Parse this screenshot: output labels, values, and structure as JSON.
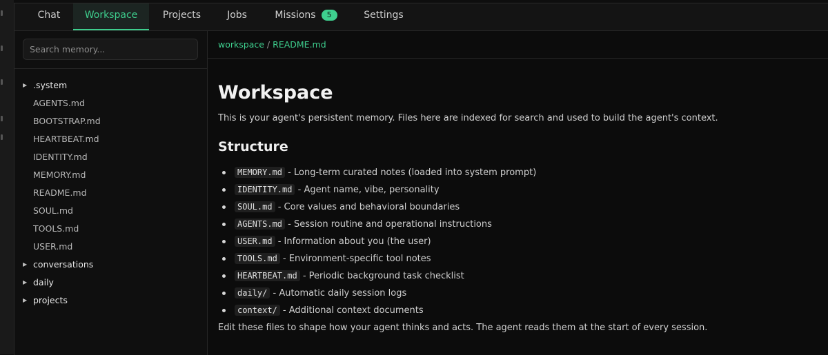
{
  "tabs": [
    {
      "label": "Chat"
    },
    {
      "label": "Workspace",
      "active": true
    },
    {
      "label": "Projects"
    },
    {
      "label": "Jobs"
    },
    {
      "label": "Missions",
      "badge": "5"
    },
    {
      "label": "Settings"
    }
  ],
  "sidebar": {
    "search_placeholder": "Search memory...",
    "tree": [
      {
        "type": "folder",
        "label": ".system"
      },
      {
        "type": "file",
        "label": "AGENTS.md"
      },
      {
        "type": "file",
        "label": "BOOTSTRAP.md"
      },
      {
        "type": "file",
        "label": "HEARTBEAT.md"
      },
      {
        "type": "file",
        "label": "IDENTITY.md"
      },
      {
        "type": "file",
        "label": "MEMORY.md"
      },
      {
        "type": "file",
        "label": "README.md"
      },
      {
        "type": "file",
        "label": "SOUL.md"
      },
      {
        "type": "file",
        "label": "TOOLS.md"
      },
      {
        "type": "file",
        "label": "USER.md"
      },
      {
        "type": "folder",
        "label": "conversations"
      },
      {
        "type": "folder",
        "label": "daily"
      },
      {
        "type": "folder",
        "label": "projects"
      }
    ]
  },
  "breadcrumb": {
    "root": "workspace",
    "separator": "/",
    "file": "README.md"
  },
  "document": {
    "title": "Workspace",
    "intro": "This is your agent's persistent memory. Files here are indexed for search and used to build the agent's context.",
    "structure_heading": "Structure",
    "items": [
      {
        "code": "MEMORY.md",
        "text": " - Long-term curated notes (loaded into system prompt)"
      },
      {
        "code": "IDENTITY.md",
        "text": " - Agent name, vibe, personality"
      },
      {
        "code": "SOUL.md",
        "text": " - Core values and behavioral boundaries"
      },
      {
        "code": "AGENTS.md",
        "text": " - Session routine and operational instructions"
      },
      {
        "code": "USER.md",
        "text": " - Information about you (the user)"
      },
      {
        "code": "TOOLS.md",
        "text": " - Environment-specific tool notes"
      },
      {
        "code": "HEARTBEAT.md",
        "text": " - Periodic background task checklist"
      },
      {
        "code": "daily/",
        "text": " - Automatic daily session logs"
      },
      {
        "code": "context/",
        "text": " - Additional context documents"
      }
    ],
    "outro": "Edit these files to shape how your agent thinks and acts. The agent reads them at the start of every session."
  },
  "colors": {
    "accent": "#3ecf8e",
    "background": "#0c0c0c"
  }
}
